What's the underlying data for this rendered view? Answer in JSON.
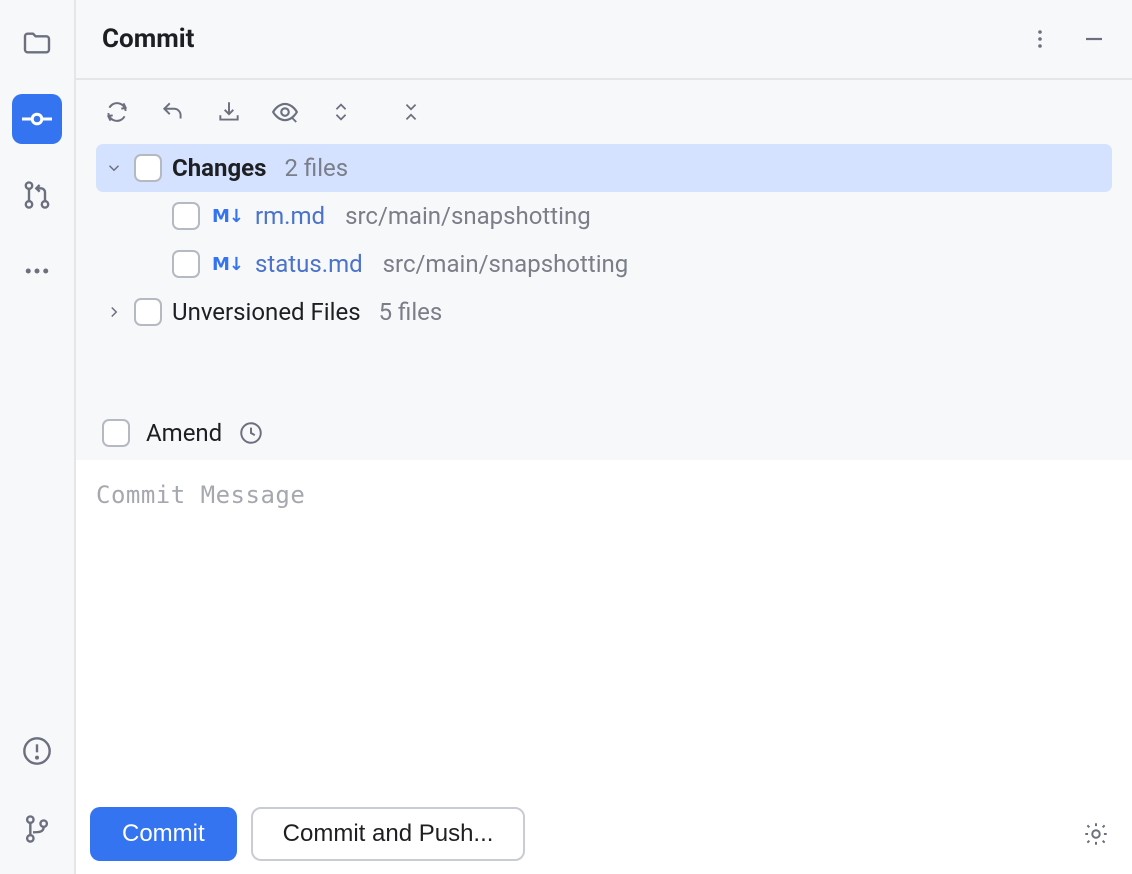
{
  "header": {
    "title": "Commit"
  },
  "tree": {
    "changes": {
      "label": "Changes",
      "sublabel": "2 files",
      "files": [
        {
          "name": "rm.md",
          "path": "src/main/snapshotting"
        },
        {
          "name": "status.md",
          "path": "src/main/snapshotting"
        }
      ]
    },
    "unversioned": {
      "label": "Unversioned Files",
      "sublabel": "5 files"
    }
  },
  "amend": {
    "label": "Amend"
  },
  "message": {
    "placeholder": "Commit Message"
  },
  "footer": {
    "commit": "Commit",
    "commit_push": "Commit and Push..."
  }
}
